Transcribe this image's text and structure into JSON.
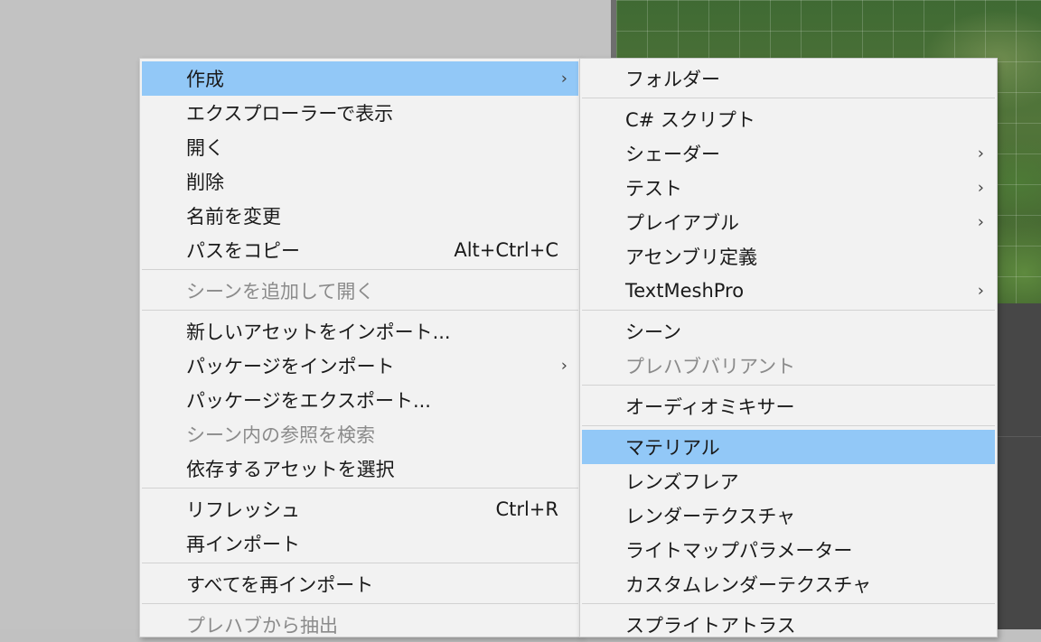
{
  "main_menu": {
    "items": [
      {
        "label": "作成",
        "submenu": true,
        "highlight": true
      },
      {
        "label": "エクスプローラーで表示"
      },
      {
        "label": "開く"
      },
      {
        "label": "削除"
      },
      {
        "label": "名前を変更"
      },
      {
        "label": "パスをコピー",
        "shortcut": "Alt+Ctrl+C"
      },
      {
        "label": "シーンを追加して開く",
        "disabled": true
      },
      {
        "label": "新しいアセットをインポート..."
      },
      {
        "label": "パッケージをインポート",
        "submenu": true
      },
      {
        "label": "パッケージをエクスポート..."
      },
      {
        "label": "シーン内の参照を検索",
        "disabled": true
      },
      {
        "label": "依存するアセットを選択"
      },
      {
        "label": "リフレッシュ",
        "shortcut": "Ctrl+R"
      },
      {
        "label": "再インポート"
      },
      {
        "label": "すべてを再インポート"
      },
      {
        "label": "プレハブから抽出",
        "disabled": true
      }
    ]
  },
  "create_submenu": {
    "items": [
      {
        "label": "フォルダー"
      },
      {
        "label": "C# スクリプト"
      },
      {
        "label": "シェーダー",
        "submenu": true
      },
      {
        "label": "テスト",
        "submenu": true
      },
      {
        "label": "プレイアブル",
        "submenu": true
      },
      {
        "label": "アセンブリ定義"
      },
      {
        "label": "TextMeshPro",
        "submenu": true
      },
      {
        "label": "シーン"
      },
      {
        "label": "プレハブバリアント",
        "disabled": true
      },
      {
        "label": "オーディオミキサー"
      },
      {
        "label": "マテリアル",
        "highlight": true
      },
      {
        "label": "レンズフレア"
      },
      {
        "label": "レンダーテクスチャ"
      },
      {
        "label": "ライトマップパラメーター"
      },
      {
        "label": "カスタムレンダーテクスチャ"
      },
      {
        "label": "スプライトアトラス"
      }
    ]
  },
  "icons": {
    "submenu_arrow": "chevron-right-icon"
  },
  "colors": {
    "highlight": "#92c8f7",
    "menu_bg": "#f2f2f2",
    "disabled_text": "#8b8b8b"
  }
}
